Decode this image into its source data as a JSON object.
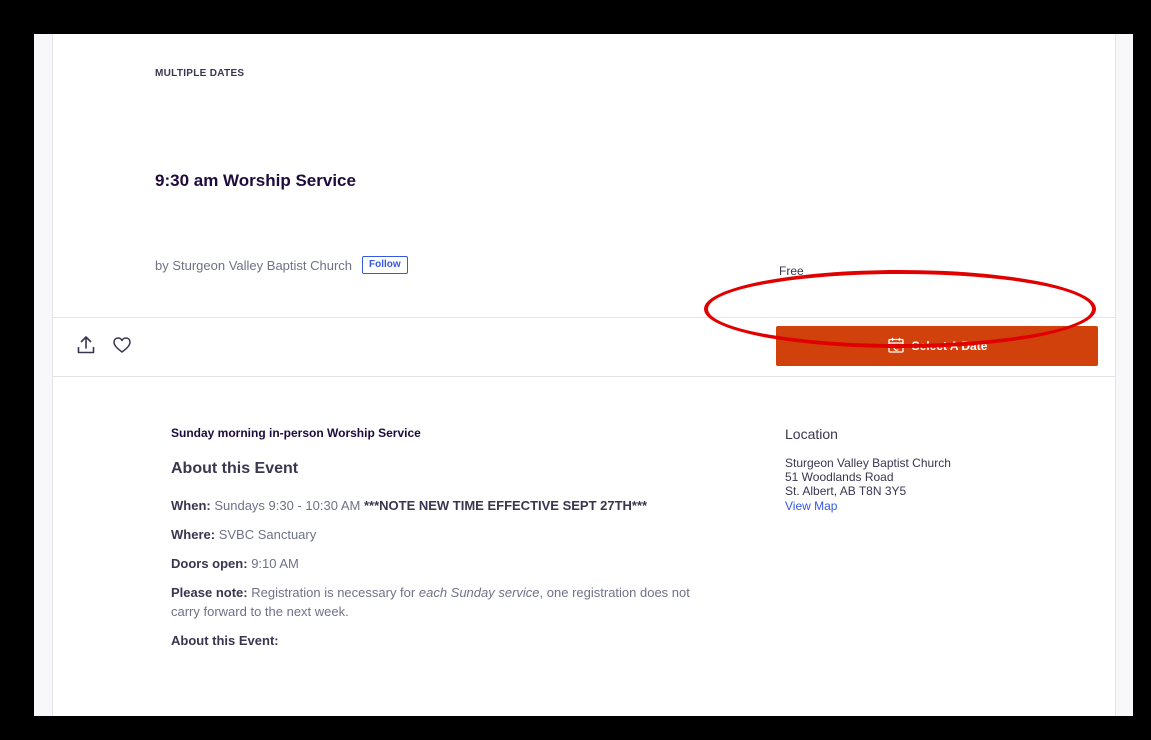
{
  "event": {
    "date_label": "MULTIPLE DATES",
    "title": "9:30 am Worship Service",
    "organizer_text": "by Sturgeon Valley Baptist Church",
    "follow_label": "Follow",
    "price": "Free"
  },
  "actions": {
    "share_icon": "share-upload-icon",
    "like_icon": "heart-icon",
    "select_date_label": "Select A Date",
    "select_date_icon": "calendar-icon",
    "button_color": "#d1410c",
    "highlight_color": "#e00000"
  },
  "details": {
    "summary": "Sunday morning in-person Worship Service",
    "about_heading": "About this Event",
    "when_label": "When:",
    "when_value": "Sundays 9:30 - 10:30 AM",
    "when_note": "***NOTE NEW TIME EFFECTIVE SEPT 27TH***",
    "where_label": "Where:",
    "where_value": "SVBC Sanctuary",
    "doors_label": "Doors open:",
    "doors_value": "9:10 AM",
    "note_label": "Please note:",
    "note_text_1": "Registration is necessary for",
    "note_emphasis": "each Sunday service",
    "note_text_2": ", one registration does not carry forward to the next week.",
    "about_sub_label": "About this Event:"
  },
  "location": {
    "heading": "Location",
    "venue": "Sturgeon Valley Baptist Church",
    "street": "51 Woodlands Road",
    "city": "St. Albert, AB T8N 3Y5",
    "map_link": "View Map"
  }
}
